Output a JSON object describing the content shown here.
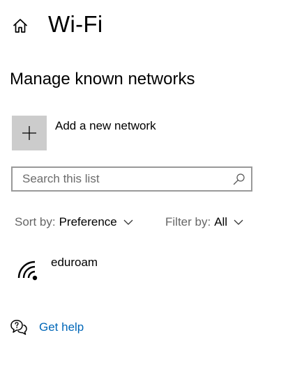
{
  "header": {
    "home_icon": "home-icon",
    "title": "Wi-Fi"
  },
  "section": {
    "heading": "Manage known networks"
  },
  "add_network": {
    "icon": "plus-icon",
    "label": "Add a new network"
  },
  "search": {
    "placeholder": "Search this list",
    "value": "",
    "icon": "search-icon"
  },
  "sort": {
    "label": "Sort by:",
    "value": "Preference"
  },
  "filter": {
    "label": "Filter by:",
    "value": "All"
  },
  "networks": [
    {
      "name": "eduroam",
      "icon": "wifi-signal-icon"
    }
  ],
  "help": {
    "icon": "help-chat-icon",
    "label": "Get help"
  },
  "colors": {
    "accent": "#0067b8",
    "tile": "#cccccc",
    "border": "#999999",
    "muted_text": "#666666"
  }
}
